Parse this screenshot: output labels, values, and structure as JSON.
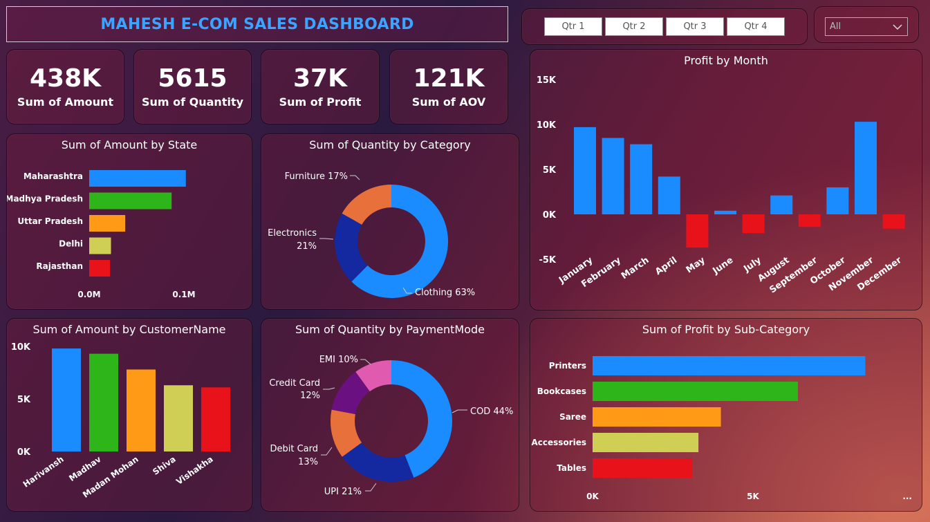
{
  "title": "MAHESH E-COM SALES DASHBOARD",
  "quarters": [
    "Qtr 1",
    "Qtr 2",
    "Qtr 3",
    "Qtr 4"
  ],
  "dropdown": {
    "selected": "All"
  },
  "kpis": [
    {
      "value": "438K",
      "label": "Sum of Amount"
    },
    {
      "value": "5615",
      "label": "Sum of Quantity"
    },
    {
      "value": "37K",
      "label": "Sum of Profit"
    },
    {
      "value": "121K",
      "label": "Sum of AOV"
    }
  ],
  "colors": {
    "blue": "#1a8cff",
    "green": "#2db51a",
    "orange": "#ff9a16",
    "yellow": "#cfcf55",
    "red": "#e8121a",
    "navy": "#1428a0",
    "coral": "#e8703a",
    "purple": "#6a1080",
    "pink": "#e05ab0"
  },
  "chart_data": [
    {
      "id": "state",
      "type": "bar",
      "orientation": "horizontal",
      "title": "Sum of Amount by State",
      "categories": [
        "Maharashtra",
        "Madhya Pradesh",
        "Uttar Pradesh",
        "Delhi",
        "Rajasthan"
      ],
      "values": [
        0.102,
        0.087,
        0.038,
        0.023,
        0.022
      ],
      "tick_labels": [
        "0.0M",
        "0.1M"
      ],
      "xlim": [
        0,
        0.1
      ],
      "colors": [
        "#1a8cff",
        "#2db51a",
        "#ff9a16",
        "#cfcf55",
        "#e8121a"
      ]
    },
    {
      "id": "category",
      "type": "pie",
      "donut": true,
      "title": "Sum of Quantity by Category",
      "labels": [
        "Clothing",
        "Electronics",
        "Furniture"
      ],
      "values": [
        63,
        21,
        17
      ],
      "display": [
        "Clothing 63%",
        "Electronics",
        "21%",
        "Furniture 17%"
      ],
      "colors": [
        "#1a8cff",
        "#1428a0",
        "#e8703a"
      ]
    },
    {
      "id": "month",
      "type": "bar",
      "title": "Profit by Month",
      "categories": [
        "January",
        "February",
        "March",
        "April",
        "May",
        "June",
        "July",
        "August",
        "September",
        "October",
        "November",
        "December"
      ],
      "values": [
        9700,
        8500,
        7800,
        4200,
        -3700,
        400,
        -2100,
        2100,
        -1400,
        3000,
        10300,
        -1600
      ],
      "tick_labels": [
        "15K",
        "10K",
        "5K",
        "0K",
        "-5K"
      ],
      "ylim": [
        -5000,
        15000
      ],
      "colors": {
        "positive": "#1a8cff",
        "negative": "#e8121a"
      }
    },
    {
      "id": "customer",
      "type": "bar",
      "title": "Sum of Amount by CustomerName",
      "categories": [
        "Harivansh",
        "Madhav",
        "Madan Mohan",
        "Shiva",
        "Vishakha"
      ],
      "values": [
        9800,
        9300,
        7800,
        6300,
        6100
      ],
      "tick_labels": [
        "10K",
        "5K",
        "0K"
      ],
      "ylim": [
        0,
        10000
      ],
      "colors": [
        "#1a8cff",
        "#2db51a",
        "#ff9a16",
        "#cfcf55",
        "#e8121a"
      ]
    },
    {
      "id": "payment",
      "type": "pie",
      "donut": true,
      "title": "Sum of Quantity by PaymentMode",
      "labels": [
        "COD",
        "UPI",
        "Debit Card",
        "Credit Card",
        "EMI"
      ],
      "values": [
        44,
        21,
        13,
        12,
        10
      ],
      "display": [
        "COD 44%",
        "UPI 21%",
        "Debit Card",
        "13%",
        "Credit Card",
        "12%",
        "EMI 10%"
      ],
      "colors": [
        "#1a8cff",
        "#1428a0",
        "#e8703a",
        "#6a1080",
        "#e05ab0"
      ]
    },
    {
      "id": "subcat",
      "type": "bar",
      "orientation": "horizontal",
      "title": "Sum of Profit by Sub-Category",
      "categories": [
        "Printers",
        "Bookcases",
        "Saree",
        "Accessories",
        "Tables"
      ],
      "values": [
        8500,
        6400,
        4000,
        3300,
        3100
      ],
      "tick_labels": [
        "0K",
        "5K",
        "..."
      ],
      "xlim": [
        0,
        5000
      ],
      "colors": [
        "#1a8cff",
        "#2db51a",
        "#ff9a16",
        "#cfcf55",
        "#e8121a"
      ]
    }
  ]
}
